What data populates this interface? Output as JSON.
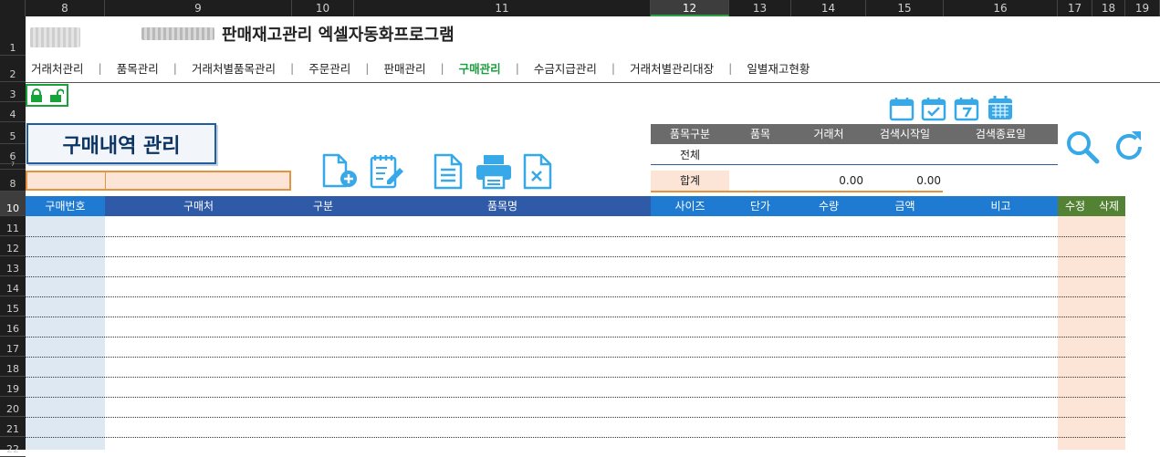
{
  "columns": [
    "8",
    "9",
    "10",
    "11",
    "12",
    "13",
    "14",
    "15",
    "16",
    "17",
    "18",
    "19"
  ],
  "rows": [
    "1",
    "2",
    "3",
    "4",
    "5",
    "6",
    "7",
    "8",
    "10",
    "11",
    "12",
    "13",
    "14",
    "15",
    "16",
    "17",
    "18",
    "19",
    "20",
    "21",
    "22"
  ],
  "title": "판매재고관리 엑셀자동화프로그램",
  "menu": [
    "거래처관리",
    "품목관리",
    "거래처별품목관리",
    "주문관리",
    "판매관리",
    "구매관리",
    "수금지급관리",
    "거래처별관리대장",
    "일별재고현황"
  ],
  "menu_active": "구매관리",
  "heading": "구매내역 관리",
  "filter": {
    "headers": [
      "품목구분",
      "품목",
      "거래처",
      "검색시작일",
      "검색종료일"
    ],
    "category_value": "전체",
    "sum_label": "합계",
    "sum_qty": "0.00",
    "sum_amount": "0.00"
  },
  "table_headers": {
    "order_no": "구매번호",
    "supplier": "구매처",
    "type": "구분",
    "item_name": "품목명",
    "size": "사이즈",
    "unit_price": "단가",
    "qty": "수량",
    "amount": "금액",
    "note": "비고",
    "edit": "수정",
    "delete": "삭제"
  },
  "colors": {
    "accent_green": "#1a9b3c",
    "header_blue": "#2f5aa8",
    "header_light_blue": "#1f7ad1",
    "header_green": "#548235",
    "icon_blue": "#37a8e8"
  }
}
